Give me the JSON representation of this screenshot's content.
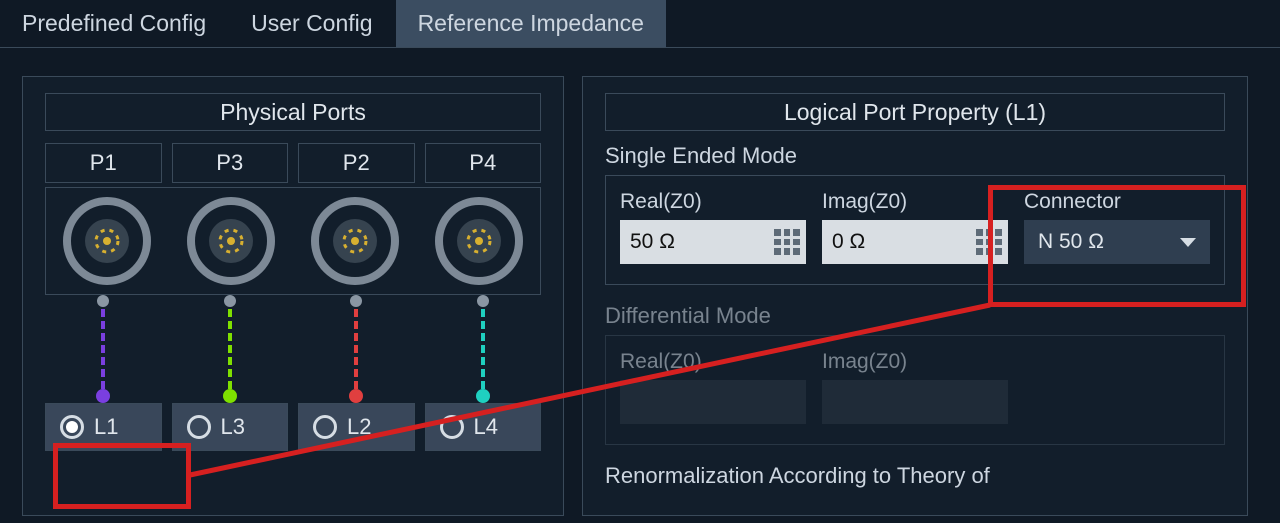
{
  "tabs": {
    "predefined": "Predefined Config",
    "user": "User Config",
    "reference": "Reference Impedance"
  },
  "left_panel": {
    "title": "Physical Ports",
    "ports": [
      "P1",
      "P3",
      "P2",
      "P4"
    ],
    "logicals": [
      "L1",
      "L3",
      "L2",
      "L4"
    ],
    "selected_logical": "L1",
    "wire_colors": [
      "#7a3fe0",
      "#7fe000",
      "#e03f3f",
      "#1fd0c0"
    ]
  },
  "right_panel": {
    "title": "Logical Port Property (L1)",
    "single_ended": {
      "label": "Single Ended Mode",
      "real_label": "Real(Z0)",
      "real_value": "50 Ω",
      "imag_label": "Imag(Z0)",
      "imag_value": "0 Ω",
      "connector_label": "Connector",
      "connector_value": "N 50 Ω"
    },
    "differential": {
      "label": "Differential Mode",
      "real_label": "Real(Z0)",
      "imag_label": "Imag(Z0)"
    },
    "renorm_label": "Renormalization According to Theory of"
  }
}
